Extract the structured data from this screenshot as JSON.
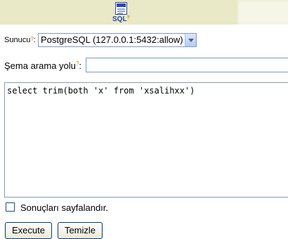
{
  "tabs": {
    "sql_tab_label": "SQL",
    "help_mark": "?"
  },
  "form": {
    "server_label": "Sunucu",
    "server_help": "?",
    "server_selected": "PostgreSQL (127.0.0.1:5432:allow)",
    "search_path_label": "Şema arama yolu",
    "search_path_help": "?",
    "search_path_value": "",
    "sql_text": "select trim(both 'x' from 'xsalihxx')",
    "paginate_label": "Sonuçları sayfalandır.",
    "paginate_checked": false
  },
  "buttons": {
    "execute": "Execute",
    "clear": "Temizle"
  }
}
